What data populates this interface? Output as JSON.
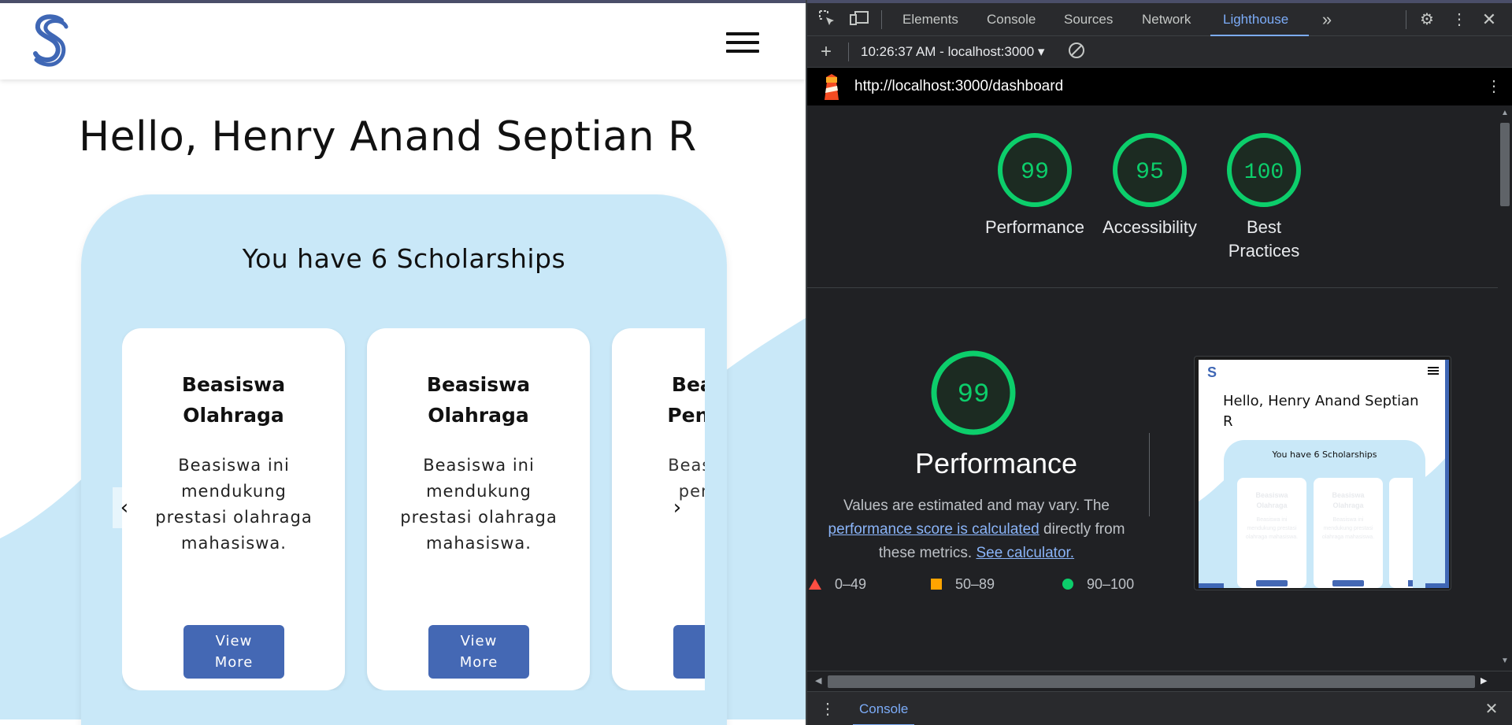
{
  "app": {
    "greeting": "Hello, Henry Anand Septian R",
    "scholarship_count_text": "You have 6 Scholarships",
    "cards": [
      {
        "title": "Beasiswa\nOlahraga",
        "description": "Beasiswa ini\nmendukung\nprestasi olahraga\nmahasiswa.",
        "button": "View\nMore"
      },
      {
        "title": "Beasiswa\nOlahraga",
        "description": "Beasiswa ini\nmendukung\nprestasi olahraga\nmahasiswa.",
        "button": "View\nMore"
      },
      {
        "title": "Beasiswa\nPenelitian",
        "description": "Beasiswa ini\npenelitian",
        "button": "View\nMore"
      }
    ],
    "prev_arrow": "‹",
    "next_arrow": "›",
    "colors": {
      "brand": "#4468b4",
      "panel": "#c9e8f8",
      "wave": "#c9e8f8"
    }
  },
  "devtools": {
    "tabs": [
      "Elements",
      "Console",
      "Sources",
      "Network",
      "Lighthouse"
    ],
    "active_tab": "Lighthouse",
    "report_select": "10:26:37 AM - localhost:3000 ▾",
    "url": "http://localhost:3000/dashboard",
    "scores": [
      {
        "label": "Performance",
        "value": "99"
      },
      {
        "label": "Accessibility",
        "value": "95"
      },
      {
        "label": "Best\nPractices",
        "value": "100"
      }
    ],
    "main_score": {
      "value": "99",
      "title": "Performance"
    },
    "description": {
      "part1": "Values are estimated and may vary. The",
      "link1": "performance score is calculated",
      "part2": "directly from these metrics.",
      "link2": "See calculator."
    },
    "legend": [
      {
        "range": "0–49",
        "color": "#ff4e42"
      },
      {
        "range": "50–89",
        "color": "#ffa400"
      },
      {
        "range": "90–100",
        "color": "#0cce6b"
      }
    ],
    "thumbnail": {
      "greeting": "Hello, Henry Anand Septian R",
      "count": "You have 6 Scholarships",
      "card_title": "Beasiswa Olahraga",
      "card_desc": "Beasiswa ini mendukung prestasi olahraga mahasiswa."
    },
    "drawer_tab": "Console",
    "colors": {
      "pass": "#0cce6b",
      "link": "#8ab4f8",
      "accent": "#7cacf8"
    }
  }
}
